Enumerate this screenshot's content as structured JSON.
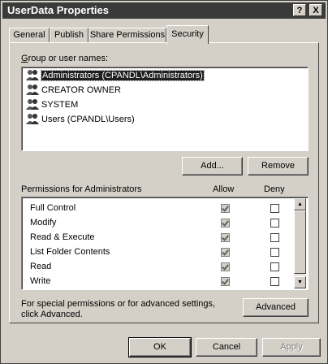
{
  "window": {
    "title": "UserData Properties"
  },
  "titlebar_buttons": {
    "help": "?",
    "close": "X"
  },
  "tabs": [
    {
      "label": "General",
      "active": false
    },
    {
      "label": "Publish",
      "active": false
    },
    {
      "label": "Share Permissions",
      "active": false
    },
    {
      "label": "Security",
      "active": true
    }
  ],
  "groups": {
    "label": "Group or user names:",
    "items": [
      {
        "label": "Administrators (CPANDL\\Administrators)",
        "selected": true
      },
      {
        "label": "CREATOR OWNER",
        "selected": false
      },
      {
        "label": "SYSTEM",
        "selected": false
      },
      {
        "label": "Users (CPANDL\\Users)",
        "selected": false
      }
    ]
  },
  "buttons": {
    "add": "Add...",
    "remove": "Remove",
    "advanced": "Advanced",
    "ok": "OK",
    "cancel": "Cancel",
    "apply": "Apply"
  },
  "permissions": {
    "label": "Permissions for Administrators",
    "allow_header": "Allow",
    "deny_header": "Deny",
    "items": [
      {
        "name": "Full Control",
        "allow": true,
        "deny": false
      },
      {
        "name": "Modify",
        "allow": true,
        "deny": false
      },
      {
        "name": "Read & Execute",
        "allow": true,
        "deny": false
      },
      {
        "name": "List Folder Contents",
        "allow": true,
        "deny": false
      },
      {
        "name": "Read",
        "allow": true,
        "deny": false
      },
      {
        "name": "Write",
        "allow": true,
        "deny": false
      }
    ]
  },
  "special_note": {
    "line1": "For special permissions or for advanced settings,",
    "line2": "click Advanced."
  },
  "colors": {
    "titlebar": "#3a3a3a",
    "face": "#d4d0c8",
    "selection": "#1f1f1f"
  }
}
